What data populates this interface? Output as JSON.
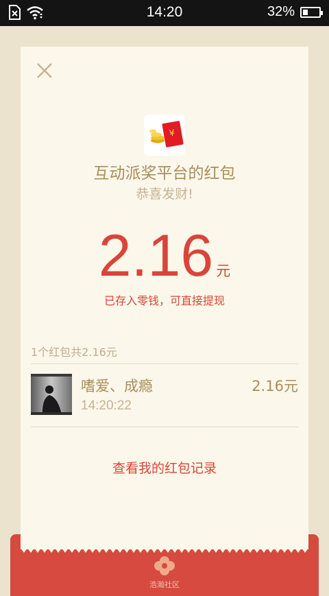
{
  "status_bar": {
    "time": "14:20",
    "battery_percent": "32%",
    "battery_level": 0.32,
    "icons": [
      "no-sim-icon",
      "wifi-icon",
      "battery-icon"
    ]
  },
  "close_icon": "close-icon",
  "packet": {
    "app_icon": "red-packet-icon",
    "title": "互动派奖平台的红包",
    "greeting": "恭喜发财!",
    "amount": "2.16",
    "unit": "元",
    "deposit_note": "已存入零钱，可直接提现"
  },
  "summary": "1个红包共2.16元",
  "records": [
    {
      "avatar": "avatar-image",
      "name": "嗜爱、成瘾",
      "time": "14:20:22",
      "amount": "2.16元"
    }
  ],
  "history_link": "查看我的红包记录",
  "footer": {
    "logo_icon": "flower-logo-icon",
    "label": "浩瀚社区"
  },
  "colors": {
    "accent_red": "#d9453a",
    "gold": "#a98e5b",
    "card_bg": "#fbf7ea",
    "page_bg": "#ece3cf"
  }
}
